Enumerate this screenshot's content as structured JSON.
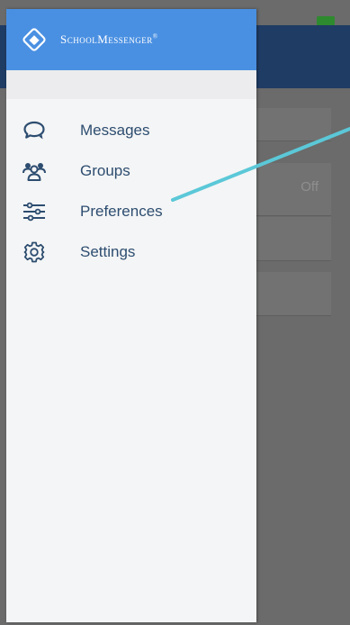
{
  "app": {
    "brand_name": "SchoolMessenger",
    "brand_mark": "®",
    "logo_icon": "schoolmessenger-logo-icon",
    "colors": {
      "header_blue": "#4a90e2",
      "label_blue": "#2d4d70",
      "annotation_cyan": "#5bc8d8"
    }
  },
  "menu": {
    "items": [
      {
        "label": "Messages",
        "icon": "chat-bubbles-icon"
      },
      {
        "label": "Groups",
        "icon": "group-people-icon"
      },
      {
        "label": "Preferences",
        "icon": "sliders-icon"
      },
      {
        "label": "Settings",
        "icon": "gear-icon"
      }
    ]
  },
  "background": {
    "toggle_value": "Off"
  }
}
